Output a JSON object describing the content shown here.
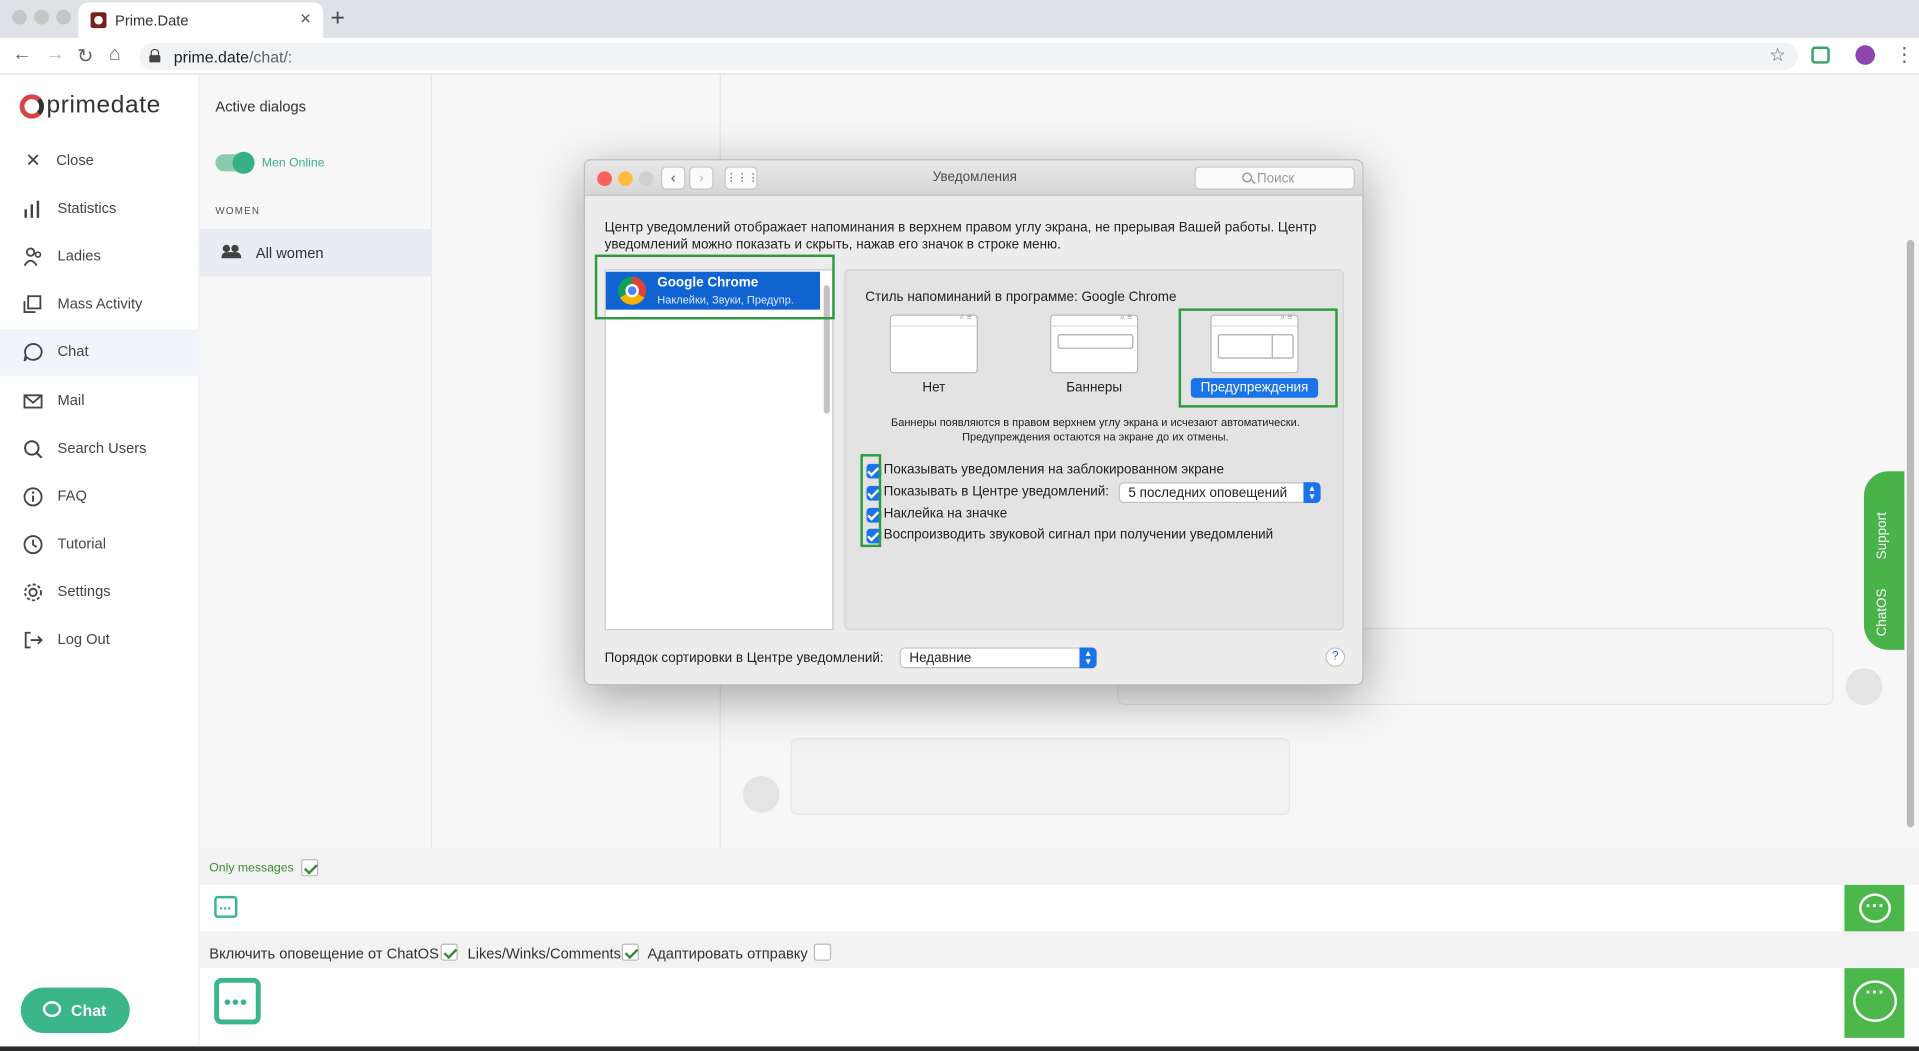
{
  "browser": {
    "tab_title": "Prime.Date",
    "url_host": "prime.date",
    "url_path": "/chat/:"
  },
  "sidebar": {
    "logo_text": "primedate",
    "close_label": "Close",
    "items": [
      {
        "label": "Statistics",
        "icon": "bar-chart-icon"
      },
      {
        "label": "Ladies",
        "icon": "ladies-icon"
      },
      {
        "label": "Mass Activity",
        "icon": "mass-activity-icon"
      },
      {
        "label": "Chat",
        "icon": "chat-bubble-icon",
        "active": true
      },
      {
        "label": "Mail",
        "icon": "mail-icon"
      },
      {
        "label": "Search Users",
        "icon": "search-icon"
      },
      {
        "label": "FAQ",
        "icon": "info-icon"
      },
      {
        "label": "Tutorial",
        "icon": "tutorial-icon"
      },
      {
        "label": "Settings",
        "icon": "gear-icon"
      },
      {
        "label": "Log Out",
        "icon": "logout-icon"
      }
    ],
    "chat_button": "Chat"
  },
  "dialogs": {
    "title": "Active dialogs",
    "toggle_label": "Men Online",
    "toggle_on": true,
    "section_label": "WOMEN",
    "all_women": "All women"
  },
  "support": {
    "support_label": "Support",
    "chatos_label": "ChatOS"
  },
  "bottom": {
    "only_messages_label": "Only messages",
    "only_messages_checked": true,
    "options": [
      {
        "label": "Включить оповещение от ChatOS",
        "checked": true
      },
      {
        "label": "Likes/Winks/Comments",
        "checked": true
      },
      {
        "label": "Адаптировать отправку",
        "checked": false
      }
    ]
  },
  "mac_dialog": {
    "title": "Уведомления",
    "search_placeholder": "Поиск",
    "description": "Центр уведомлений отображает напоминания в верхнем правом углу экрана, не прерывая Вашей работы. Центр уведомлений можно показать и скрыть, нажав его значок в строке меню.",
    "app_name": "Google Chrome",
    "app_subtitle": "Наклейки, Звуки, Предупр.",
    "style_title": "Стиль напоминаний в программе: Google Chrome",
    "styles": [
      {
        "label": "Нет",
        "selected": false
      },
      {
        "label": "Баннеры",
        "selected": false
      },
      {
        "label": "Предупреждения",
        "selected": true
      }
    ],
    "style_note_line1": "Баннеры появляются в правом верхнем углу экрана и исчезают автоматически.",
    "style_note_line2": "Предупреждения остаются на экране до их отмены.",
    "checkboxes": [
      {
        "label": "Показывать уведомления на заблокированном экране",
        "checked": true
      },
      {
        "label": "Показывать в Центре уведомлений:",
        "checked": true
      },
      {
        "label": "Наклейка на значке",
        "checked": true
      },
      {
        "label": "Воспроизводить звуковой сигнал при получении уведомлений",
        "checked": true
      }
    ],
    "recent_count_value": "5 последних оповещений",
    "sort_label": "Порядок сортировки в Центре уведомлений:",
    "sort_value": "Недавние",
    "help_label": "?"
  },
  "colors": {
    "brand_green": "#3bb58a",
    "support_green": "#4cb84c",
    "highlight_green": "#2f9a3e",
    "mac_blue": "#1a73e8"
  }
}
